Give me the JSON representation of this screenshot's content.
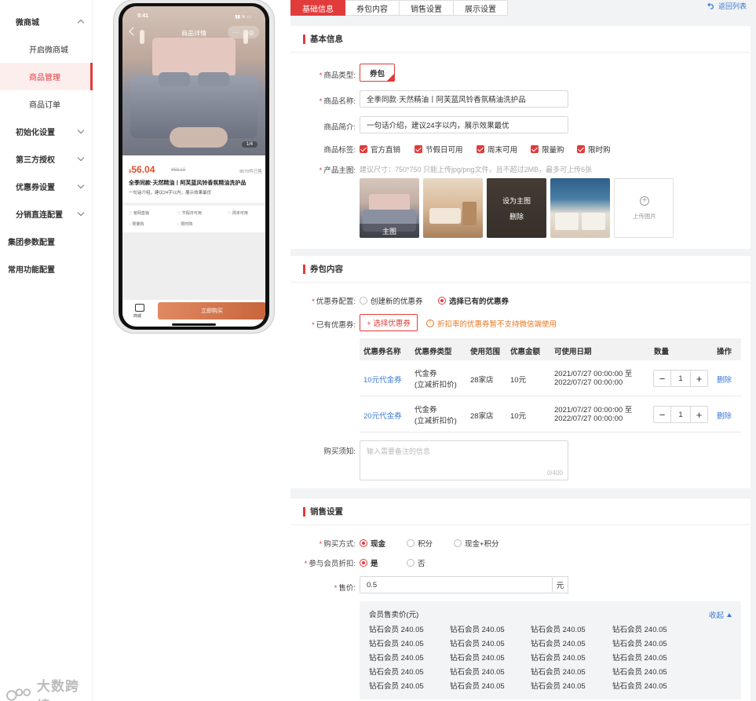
{
  "sidebar": {
    "group_mall": "微商城",
    "sub_items": [
      "开启微商城",
      "商品管理",
      "商品订单"
    ],
    "groups": [
      "初始化设置",
      "第三方授权",
      "优惠券设置",
      "分销直连配置"
    ],
    "top_items": [
      "集团参数配置",
      "常用功能配置"
    ],
    "watermark": "大数跨境"
  },
  "preview": {
    "time": "9:41",
    "status": "▮▮ ≋ ▭",
    "nav_title": "商品详情",
    "nav_caps": [
      "···",
      "◎"
    ],
    "image_counter": "1/4",
    "currency": "¥",
    "price": "56.04",
    "orig_price": "¥68.10",
    "sold": "8670件已售",
    "title": "全季同款·天然精油丨阿芙蓝风铃香氛精油洗护品",
    "desc": "一句话介绍，建议24字以内，展示效果最优",
    "tags": [
      "官网直销",
      "节假日可用",
      "周末可用",
      "限量购",
      "限时购"
    ],
    "shop_label": "商城",
    "buy_label": "立即购买"
  },
  "tabs": [
    "基础信息",
    "券包内容",
    "销售设置",
    "展示设置"
  ],
  "back_link": "返回列表",
  "basic": {
    "heading": "基本信息",
    "type_label": "商品类型:",
    "type_value": "券包",
    "name_label": "商品名称:",
    "name_value": "全季同款·天然精油丨阿芙蓝风铃香氛精油洗护品",
    "intro_label": "商品简介:",
    "intro_value": "一句话介绍，建议24字以内，展示效果最优",
    "tags_label": "商品标签:",
    "tags": [
      "官方直销",
      "节假日可用",
      "周末可用",
      "限量购",
      "限时购"
    ],
    "image_label": "产品主图:",
    "image_hint": "建议尺寸：750*750  只能上传jpg/png文件，且不超过2MB，最多可上传6张",
    "main_caption": "主图",
    "set_main": "设为主图",
    "delete": "删除",
    "upload": "上传图片"
  },
  "package": {
    "heading": "券包内容",
    "config_label": "优惠券配置:",
    "opt_new": "创建新的优惠券",
    "opt_existing": "选择已有的优惠券",
    "existing_label": "已有优惠券:",
    "select_button": "+ 选择优惠券",
    "warning": "折扣率的优惠券暂不支持微信端使用",
    "columns": [
      "优惠券名称",
      "优惠券类型",
      "使用范围",
      "优惠金额",
      "可使用日期",
      "数量",
      "操作"
    ],
    "rows": [
      {
        "name": "10元代金券",
        "type1": "代金券",
        "type2": "(立减折扣价)",
        "scope": "28家店",
        "amount": "10元",
        "date1": "2021/07/27 00:00:00 至",
        "date2": "2022/07/27 00:00:00",
        "qty": "1",
        "action": "删除"
      },
      {
        "name": "20元代金券",
        "type1": "代金券",
        "type2": "(立减折扣价)",
        "scope": "28家店",
        "amount": "10元",
        "date1": "2021/07/27 00:00:00 至",
        "date2": "2022/07/27 00:00:00",
        "qty": "1",
        "action": "删除"
      }
    ],
    "notice_label": "购买须知:",
    "notice_placeholder": "输入需要备注的信息",
    "notice_counter": "0/400"
  },
  "sales": {
    "heading": "销售设置",
    "buy_label": "购买方式:",
    "buy_options": [
      "现金",
      "积分",
      "现金+积分"
    ],
    "member_label": "参与会员折扣:",
    "member_options": [
      "是",
      "否"
    ],
    "price_label": "售价:",
    "price_value": "0.5",
    "price_unit": "元",
    "member_price_title": "会员售卖价(元)",
    "collapse": "收起",
    "member_price_cell": "钻石会员 240.05"
  },
  "colors": {
    "accent": "#e23b3b",
    "link": "#3b79d4",
    "warning": "#e87722"
  }
}
